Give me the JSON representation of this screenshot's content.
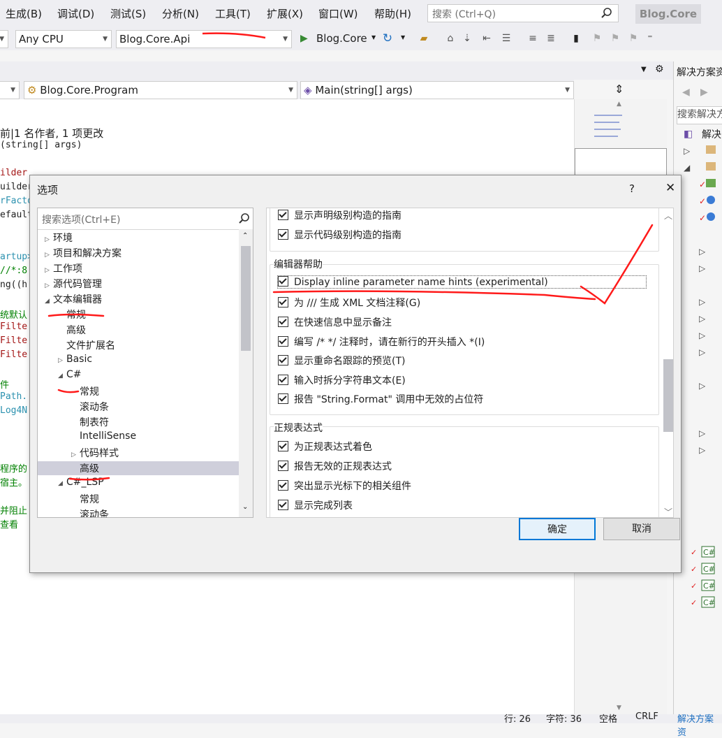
{
  "menubar": {
    "items": [
      "生成(B)",
      "调试(D)",
      "测试(S)",
      "分析(N)",
      "工具(T)",
      "扩展(X)",
      "窗口(W)",
      "帮助(H)"
    ],
    "search_placeholder": "搜索 (Ctrl+Q)",
    "app_title": "Blog.Core"
  },
  "toolbar": {
    "platform": "Any CPU",
    "project": "Blog.Core.Api",
    "run_target": "Blog.Core"
  },
  "nav": {
    "class_combo": "Blog.Core.Program",
    "member_combo": "Main(string[] args)"
  },
  "editor": {
    "lines": [
      {
        "text": "前|1 名作者, 1 项更改",
        "color": "#9a9a9a"
      },
      {
        "text": "(string[] args)",
        "color": "#1e1e1e"
      },
      {
        "text": "ilder",
        "color": "#a31515"
      },
      {
        "text": "uilder",
        "color": "#1e1e1e"
      },
      {
        "text": "rFacto",
        "color": "#2b91af"
      },
      {
        "text": "efault",
        "color": "#1e1e1e"
      },
      {
        "text": "artup>",
        "color": "#2b91af"
      },
      {
        "text": " //*:8",
        "color": "#008000"
      },
      {
        "text": "ng((h",
        "color": "#1e1e1e"
      },
      {
        "text": "统默认",
        "color": "#008000"
      },
      {
        "text": "Filte",
        "color": "#a31515"
      },
      {
        "text": "Filte",
        "color": "#a31515"
      },
      {
        "text": "Filte",
        "color": "#a31515"
      },
      {
        "text": "件",
        "color": "#008000"
      },
      {
        "text": "Path.",
        "color": "#2b91af"
      },
      {
        "text": "Log4N",
        "color": "#2b91af"
      },
      {
        "text": "程序的",
        "color": "#008000"
      },
      {
        "text": "宿主。",
        "color": "#008000"
      },
      {
        "text": "并阻止",
        "color": "#008000"
      },
      {
        "text": "查看",
        "color": "#008000"
      }
    ]
  },
  "right_panel": {
    "title": "解决方案资",
    "search": "搜索解决方",
    "root": "解决"
  },
  "statusbar": {
    "line": "行: 26",
    "char": "字符: 36",
    "mode": "空格",
    "eol": "CRLF",
    "tab": "解决方案资"
  },
  "dialog": {
    "title": "选项",
    "help": "?",
    "close": "✕",
    "tree_search_placeholder": "搜索选项(Ctrl+E)",
    "tree": [
      {
        "label": "环境",
        "indent": 0,
        "tri": "▷"
      },
      {
        "label": "项目和解决方案",
        "indent": 0,
        "tri": "▷"
      },
      {
        "label": "工作项",
        "indent": 0,
        "tri": "▷"
      },
      {
        "label": "源代码管理",
        "indent": 0,
        "tri": "▷"
      },
      {
        "label": "文本编辑器",
        "indent": 0,
        "tri": "◢"
      },
      {
        "label": "常规",
        "indent": 1,
        "tri": ""
      },
      {
        "label": "高级",
        "indent": 1,
        "tri": ""
      },
      {
        "label": "文件扩展名",
        "indent": 1,
        "tri": ""
      },
      {
        "label": "Basic",
        "indent": 1,
        "tri": "▷"
      },
      {
        "label": "C#",
        "indent": 1,
        "tri": "◢"
      },
      {
        "label": "常规",
        "indent": 2,
        "tri": ""
      },
      {
        "label": "滚动条",
        "indent": 2,
        "tri": ""
      },
      {
        "label": "制表符",
        "indent": 2,
        "tri": ""
      },
      {
        "label": "IntelliSense",
        "indent": 2,
        "tri": ""
      },
      {
        "label": "代码样式",
        "indent": 2,
        "tri": "▷"
      },
      {
        "label": "高级",
        "indent": 2,
        "tri": "",
        "selected": true
      },
      {
        "label": "C#_LSP",
        "indent": 1,
        "tri": "◢"
      },
      {
        "label": "常规",
        "indent": 2,
        "tri": ""
      },
      {
        "label": "滚动条",
        "indent": 2,
        "tri": ""
      }
    ],
    "top_options": [
      "显示声明级别构造的指南",
      "显示代码级别构造的指南"
    ],
    "editor_help": {
      "title": "编辑器帮助",
      "options": [
        "Display inline parameter name hints (experimental)",
        "为 /// 生成 XML 文档注释(G)",
        "在快速信息中显示备注",
        "编写 /* */ 注释时，请在新行的开头插入 *(I)",
        "显示重命名跟踪的预览(T)",
        "输入时拆分字符串文本(E)",
        "报告 \"String.Format\" 调用中无效的占位符"
      ]
    },
    "regex": {
      "title": "正规表达式",
      "options": [
        "为正规表达式着色",
        "报告无效的正规表达式",
        "突出显示光标下的相关组件",
        "显示完成列表"
      ]
    },
    "ok": "确定",
    "cancel": "取消"
  },
  "colors": {
    "accent": "#0078d7",
    "annotation_red": "#ff1a1a",
    "selection": "#cce0f4"
  }
}
